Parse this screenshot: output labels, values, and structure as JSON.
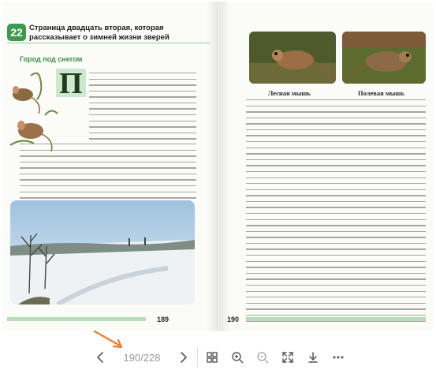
{
  "left_page": {
    "lesson_number": "22",
    "lesson_title": "Страница двадцать вторая, которая рассказывает о зимней жизни зверей",
    "section_heading": "Город под снегом",
    "drop_cap": "П",
    "page_number": "189"
  },
  "right_page": {
    "caption_left": "Лесная мышь",
    "caption_right": "Полевая мышь",
    "page_number": "190"
  },
  "toolbar": {
    "prev_icon": "chevron-left-icon",
    "page_indicator": "190/228",
    "next_icon": "chevron-right-icon",
    "grid_icon": "grid-icon",
    "zoom_in_icon": "zoom-in-icon",
    "zoom_out_icon": "zoom-out-icon",
    "fullscreen_icon": "fullscreen-icon",
    "download_icon": "download-icon",
    "more_icon": "more-icon"
  },
  "colors": {
    "accent_green": "#3a9a4e",
    "annotation_arrow": "#f07a2a",
    "toolbar_icon": "#555555"
  }
}
